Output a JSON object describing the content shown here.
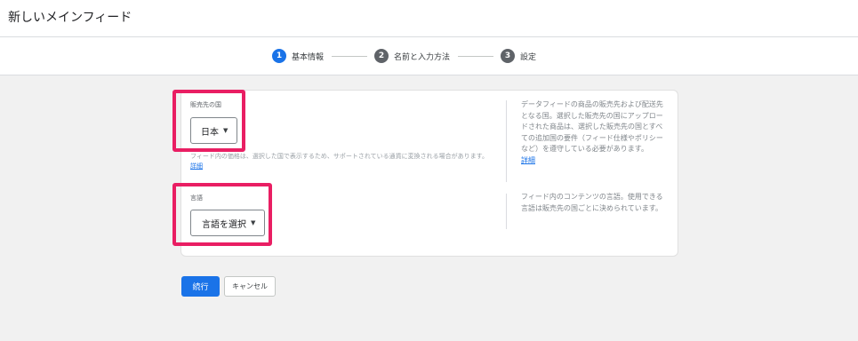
{
  "header": {
    "title": "新しいメインフィード"
  },
  "stepper": {
    "steps": [
      {
        "number": "1",
        "label": "基本情報",
        "active": true
      },
      {
        "number": "2",
        "label": "名前と入力方法",
        "active": false
      },
      {
        "number": "3",
        "label": "設定",
        "active": false
      }
    ]
  },
  "country": {
    "label": "販売先の国",
    "value": "日本",
    "hint": "フィード内の価格は、選択した国で表示するため、サポートされている通貨に変換される場合があります。",
    "hint_link": "詳細",
    "help": "データフィードの商品の販売先および配送先となる国。選択した販売先の国にアップロードされた商品は、選択した販売先の国とすべての追加国の要件（フィード仕様やポリシーなど）を遵守している必要があります。",
    "help_link": "詳細"
  },
  "language": {
    "label": "言語",
    "value": "言語を選択",
    "help": "フィード内のコンテンツの言語。使用できる言語は販売先の国ごとに決められています。"
  },
  "actions": {
    "continue_label": "続行",
    "cancel_label": "キャンセル"
  },
  "colors": {
    "accent": "#1a73e8",
    "inactive_step": "#5f6368",
    "highlight": "#e91e63"
  }
}
